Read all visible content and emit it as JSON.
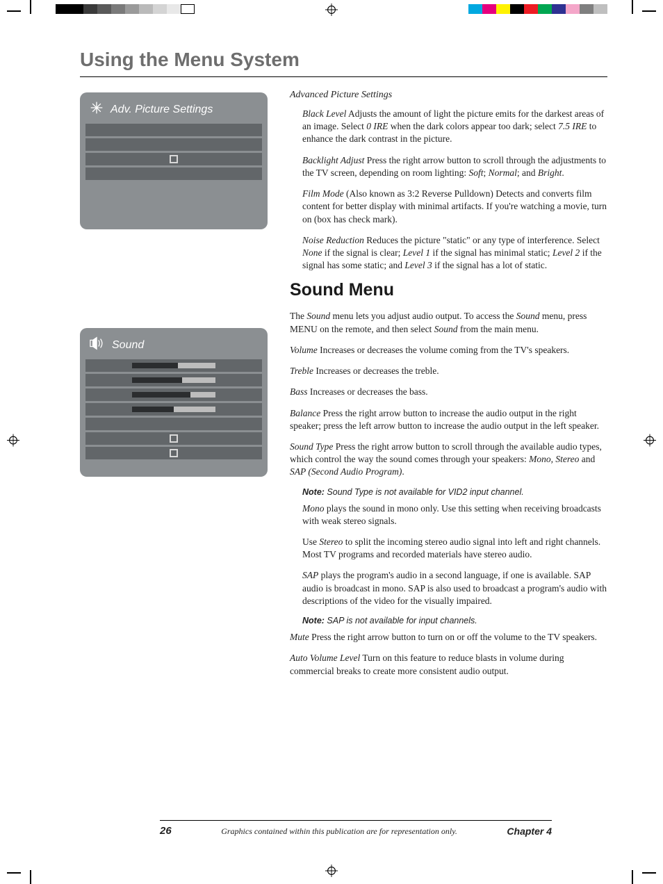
{
  "chapterTitle": "Using the Menu System",
  "figure1": {
    "title": "Adv. Picture Settings"
  },
  "figure2": {
    "title": "Sound"
  },
  "advSection": {
    "heading": "Advanced Picture Settings",
    "blackLevel": {
      "term": "Black Level",
      "body1": "   Adjusts the amount of light the picture emits for the darkest areas of an image. Select ",
      "ire0": "0 IRE",
      "body2": " when the dark colors appear too dark; select ",
      "ire75": "7.5 IRE",
      "body3": " to enhance the dark contrast in the picture."
    },
    "backlight": {
      "term": "Backlight Adjust",
      "body1": "   Press the right arrow button to scroll through the adjustments to the TV screen, depending on room lighting: ",
      "soft": "Soft",
      "sep1": "; ",
      "normal": "Normal",
      "sep2": "; and ",
      "bright": "Bright",
      "period": "."
    },
    "filmMode": {
      "term": "Film Mode",
      "body": " (Also known as 3:2 Reverse Pulldown)   Detects and converts film content for better display with minimal artifacts. If you're watching a movie, turn on (box has check mark)."
    },
    "noise": {
      "term": "Noise Reduction",
      "body1": "    Reduces the picture \"static\" or any type of interference. Select ",
      "none": "None",
      "body2": " if the signal is clear; ",
      "l1": "Level 1",
      "body3": " if the signal has minimal static; ",
      "l2": "Level 2",
      "body4": " if the signal has some static; and ",
      "l3": "Level 3",
      "body5": " if the signal has a lot of static."
    }
  },
  "soundSection": {
    "heading": "Sound Menu",
    "intro1": "The ",
    "introTerm1": "Sound",
    "intro2": " menu lets you adjust audio output. To access the ",
    "introTerm2": "Sound",
    "intro3": " menu, press MENU on the remote, and then select ",
    "introTerm3": "Sound",
    "intro4": " from the main menu.",
    "volume": {
      "term": "Volume",
      "body": "   Increases or decreases the volume coming from the TV's speakers."
    },
    "treble": {
      "term": "Treble",
      "body": "  Increases or decreases the treble."
    },
    "bass": {
      "term": "Bass",
      "body": "  Increases or decreases the bass."
    },
    "balance": {
      "term": "Balance",
      "body": "  Press the right arrow button to increase the audio output in the right speaker; press the left arrow button to increase the audio output in the left speaker."
    },
    "soundType": {
      "term": "Sound Type",
      "body1": "   Press the right arrow button to scroll through the available audio types, which control the way the sound comes through your speakers: ",
      "mono": "Mono, Stereo",
      "body2": " and ",
      "sap": "SAP (Second Audio Program)",
      "body3": "."
    },
    "note1Label": "Note:",
    "note1": " Sound Type is not available for VID2 input channel.",
    "monoPara": {
      "term": "Mono",
      "body": " plays the sound in mono only. Use this setting when receiving broadcasts with weak stereo signals."
    },
    "stereoPara": {
      "pre": "Use ",
      "term": "Stereo",
      "body": " to split the incoming stereo audio signal into left and right channels. Most TV programs and recorded materials have stereo audio."
    },
    "sapPara": {
      "term": "SAP",
      "body": " plays the program's audio in a second language, if one is available. SAP audio is broadcast in mono. SAP is also used to broadcast a program's audio with descriptions of the video for the visually impaired."
    },
    "note2Label": "Note:",
    "note2": " SAP is not available for input channels.",
    "mute": {
      "term": "Mute",
      "body": "   Press the right arrow button to turn on or off the volume to the TV speakers."
    },
    "autoVol": {
      "term": "Auto Volume Level",
      "body": "   Turn on this feature to reduce blasts in volume during commercial breaks to create more consistent audio output."
    }
  },
  "footer": {
    "pageNumber": "26",
    "caption": "Graphics contained within this publication are for representation only.",
    "chapter": "Chapter 4"
  }
}
